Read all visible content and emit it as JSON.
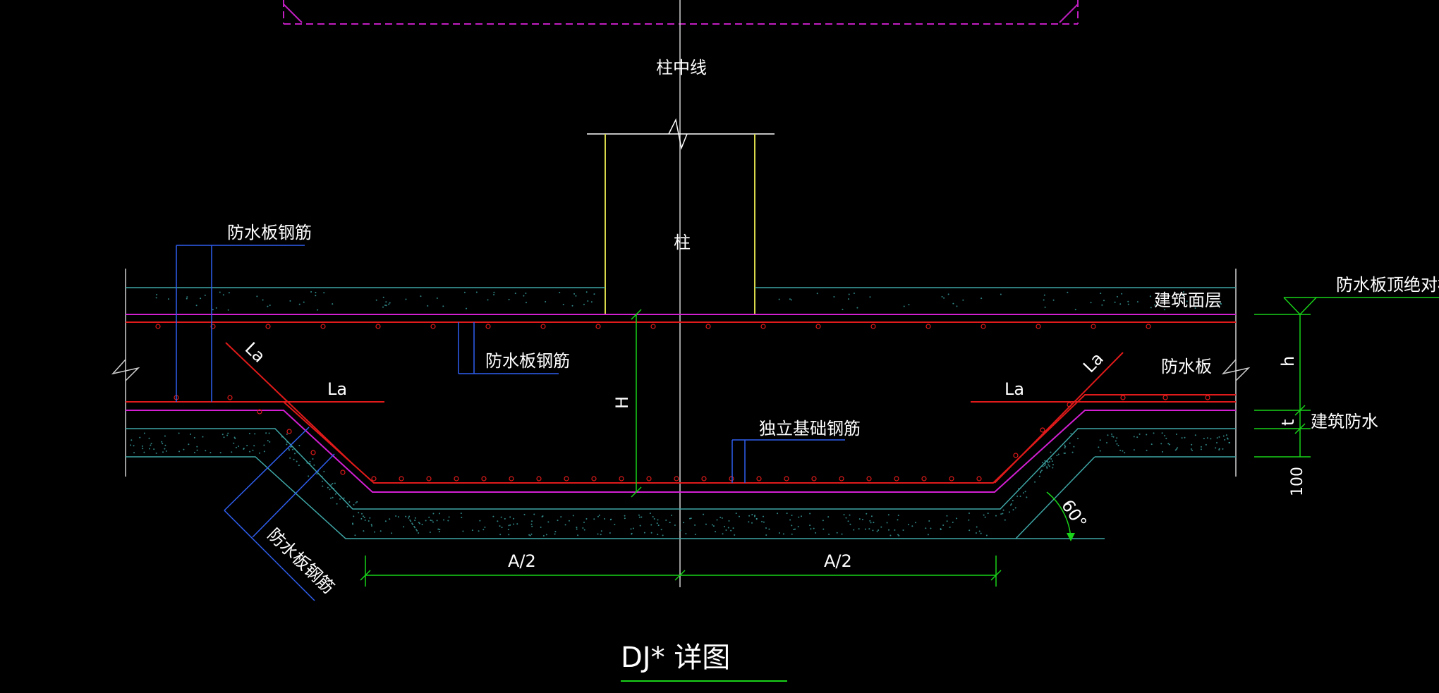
{
  "drawing": {
    "title": "DJ* 详图",
    "labels": {
      "column_centerline": "柱中线",
      "column": "柱",
      "waterproof_rebar_left_top": "防水板钢筋",
      "waterproof_rebar_mid": "防水板钢筋",
      "waterproof_rebar_slope": "防水板钢筋",
      "footing_rebar": "独立基础钢筋",
      "finish_layer": "建筑面层",
      "slab_top_elev": "防水板顶绝对标高",
      "waterproof_slab": "防水板",
      "building_waterproof": "建筑防水",
      "la_left_horizontal": "La",
      "la_left_slope": "La",
      "la_right_horizontal": "La",
      "la_right_slope": "La",
      "dim_H": "H",
      "dim_h": "h",
      "dim_t": "t",
      "dim_100": "100",
      "dim_half_left": "A/2",
      "dim_half_right": "A/2",
      "angle": "60°"
    }
  },
  "colors": {
    "background": "#000000",
    "rebar_red": "#e01a1a",
    "magenta": "#d21fd2",
    "cyan_concrete": "#3fa6a6",
    "blue_leader": "#2f5ff0",
    "green_dim": "#19d219",
    "yellow_column": "#d8d84a",
    "white_line": "#d0d0d0",
    "frame_magenta_dashed": "#c01ec0"
  }
}
